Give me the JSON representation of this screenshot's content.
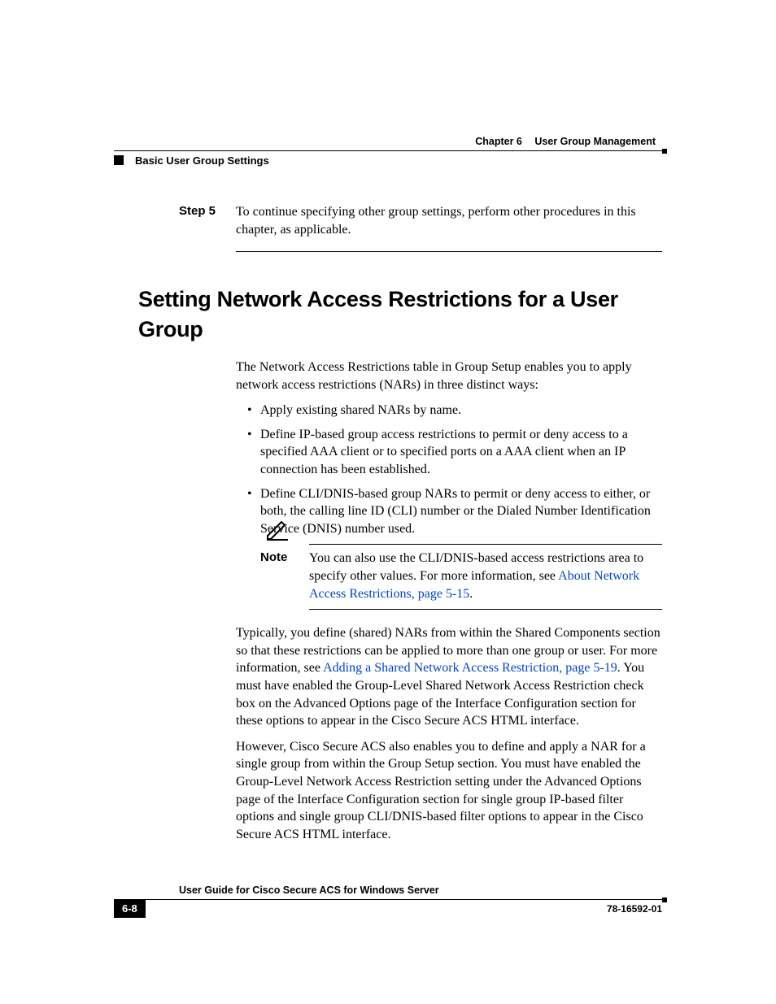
{
  "header": {
    "chapter_label": "Chapter 6",
    "chapter_title": "User Group Management",
    "section_crumb": "Basic User Group Settings"
  },
  "step": {
    "label": "Step 5",
    "text": "To continue specifying other group settings, perform other procedures in this chapter, as applicable."
  },
  "heading": "Setting Network Access Restrictions for a User Group",
  "intro": "The Network Access Restrictions table in Group Setup enables you to apply network access restrictions (NARs) in three distinct ways:",
  "bullets": [
    "Apply existing shared NARs by name.",
    "Define IP-based group access restrictions to permit or deny access to a specified AAA client or to specified ports on a AAA client when an IP connection has been established.",
    "Define CLI/DNIS-based group NARs to permit or deny access to either, or both, the calling line ID (CLI) number or the Dialed Number Identification Service (DNIS) number used."
  ],
  "note": {
    "label": "Note",
    "text_pre": "You can also use the CLI/DNIS-based access restrictions area to specify other values. For more information, see ",
    "link": "About Network Access Restrictions, page 5-15",
    "text_post": "."
  },
  "para2_pre": "Typically, you define (shared) NARs from within the Shared Components section so that these restrictions can be applied to more than one group or user. For more information, see ",
  "para2_link": "Adding a Shared Network Access Restriction, page 5-19",
  "para2_post": ". You must have enabled the Group-Level Shared Network Access Restriction check box on the Advanced Options page of the Interface Configuration section for these options to appear in the Cisco Secure ACS HTML interface.",
  "para3": "However, Cisco Secure ACS also enables you to define and apply a NAR for a single group from within the Group Setup section. You must have enabled the Group-Level Network Access Restriction setting under the Advanced Options page of the Interface Configuration section for single group IP-based filter options and single group CLI/DNIS-based filter options to appear in the Cisco Secure ACS HTML interface.",
  "footer": {
    "guide_title": "User Guide for Cisco Secure ACS for Windows Server",
    "page_number": "6-8",
    "doc_number": "78-16592-01"
  }
}
